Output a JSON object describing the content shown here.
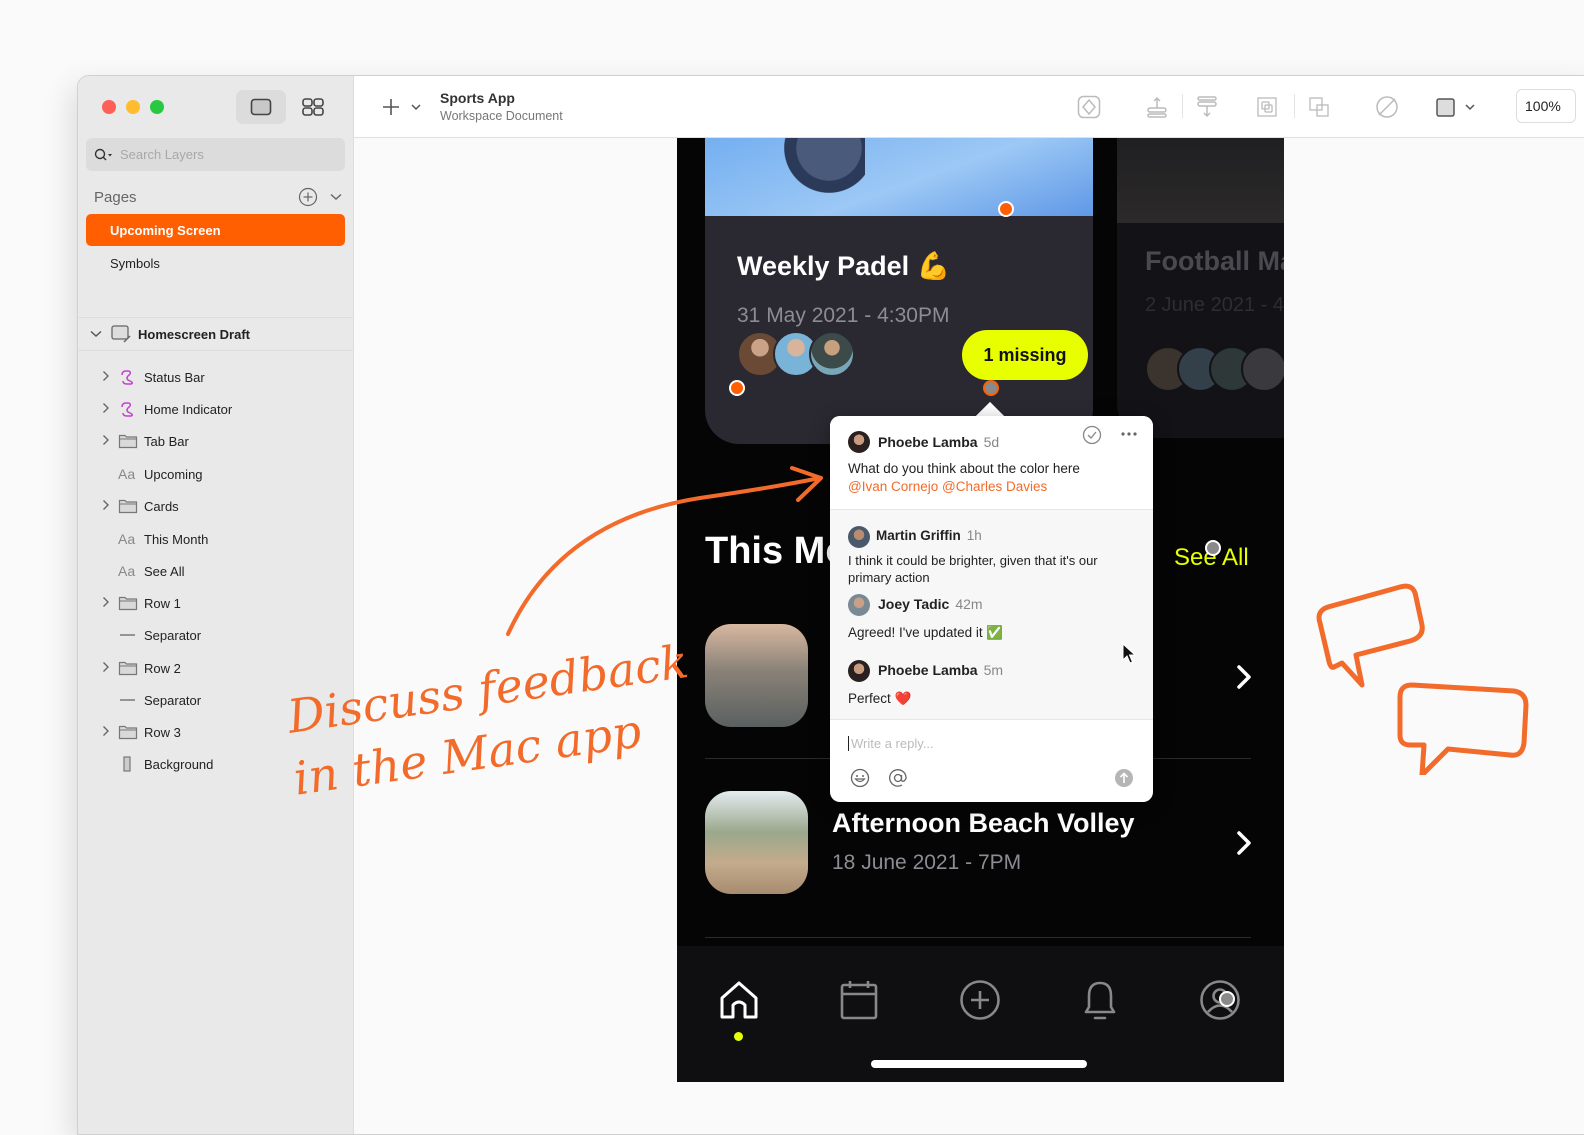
{
  "window": {
    "title": "Sports App",
    "subtitle": "Workspace Document",
    "zoom_level": "100%"
  },
  "sidebar": {
    "search_placeholder": "Search Layers",
    "pages_label": "Pages",
    "pages": [
      {
        "label": "Upcoming Screen",
        "selected": true
      },
      {
        "label": "Symbols",
        "selected": false
      }
    ],
    "artboard": "Homescreen Draft",
    "layers": [
      {
        "label": "Status Bar",
        "icon": "symbol-icon",
        "expandable": true
      },
      {
        "label": "Home Indicator",
        "icon": "symbol-icon",
        "expandable": true
      },
      {
        "label": "Tab Bar",
        "icon": "folder-icon",
        "expandable": true
      },
      {
        "label": "Upcoming",
        "icon": "text-icon",
        "expandable": false
      },
      {
        "label": "Cards",
        "icon": "folder-icon",
        "expandable": true
      },
      {
        "label": "This Month",
        "icon": "text-icon",
        "expandable": false
      },
      {
        "label": "See All",
        "icon": "text-icon",
        "expandable": false
      },
      {
        "label": "Row 1",
        "icon": "folder-icon",
        "expandable": true
      },
      {
        "label": "Separator",
        "icon": "line-icon",
        "expandable": false
      },
      {
        "label": "Row 2",
        "icon": "folder-icon",
        "expandable": true
      },
      {
        "label": "Separator",
        "icon": "line-icon",
        "expandable": false
      },
      {
        "label": "Row 3",
        "icon": "folder-icon",
        "expandable": true
      },
      {
        "label": "Background",
        "icon": "rectangle-icon",
        "expandable": false
      }
    ]
  },
  "phone": {
    "cards": [
      {
        "title": "Weekly Padel 💪",
        "date": "31 May 2021 - 4:30PM",
        "badge": "1 missing"
      },
      {
        "title": "Football Match",
        "date": "2 June 2021 - 4"
      }
    ],
    "section_title": "This Month",
    "see_all": "See All",
    "rows": [
      {
        "title": "",
        "date": ""
      },
      {
        "title": "Afternoon Beach Volley",
        "date": "18 June 2021 - 7PM"
      }
    ],
    "tabs": [
      "home-icon",
      "calendar-icon",
      "plus-circle-icon",
      "bell-icon",
      "profile-icon"
    ]
  },
  "comments": {
    "thread": {
      "author": "Phoebe Lamba",
      "time": "5d",
      "text": "What do you think about the color here",
      "mentions": "@Ivan Cornejo @Charles Davies"
    },
    "replies": [
      {
        "author": "Martin Griffin",
        "time": "1h",
        "text": "I think it could be brighter, given that it's our primary action"
      },
      {
        "author": "Joey Tadic",
        "time": "42m",
        "text": "Agreed! I've updated it ✅"
      },
      {
        "author": "Phoebe Lamba",
        "time": "5m",
        "text": "Perfect ❤️"
      }
    ],
    "reply_placeholder": "Write a reply..."
  },
  "annotation": {
    "line1": "Discuss feedback",
    "line2": "in the Mac app"
  },
  "colors": {
    "accent": "#ff5f00",
    "highlight": "#e8ff00",
    "annotation": "#f26b2a"
  }
}
